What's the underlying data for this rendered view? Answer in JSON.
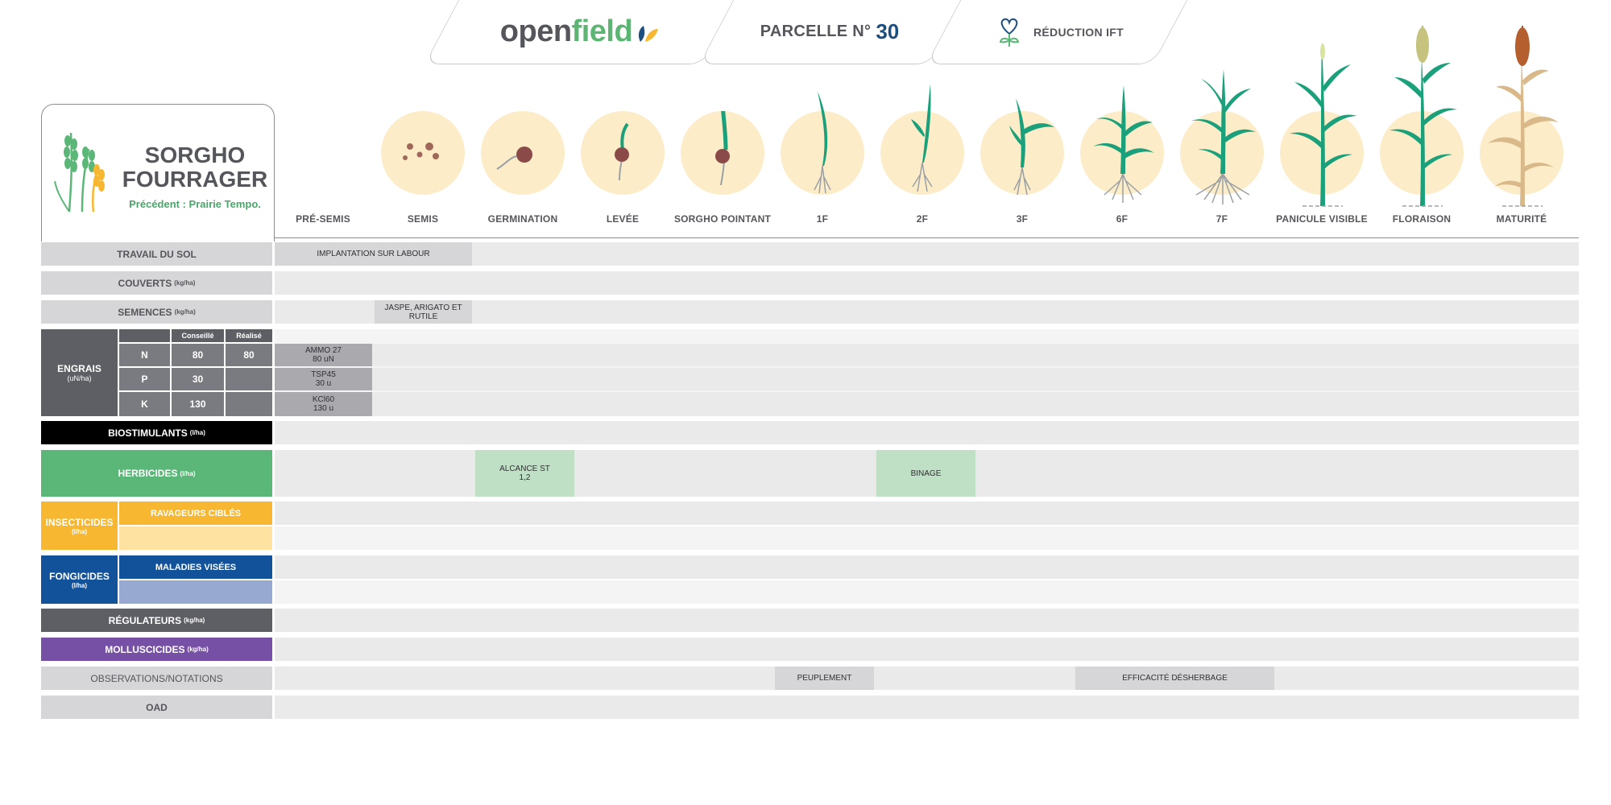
{
  "header": {
    "logo_part1": "open",
    "logo_part2": "field",
    "parcelle_label": "PARCELLE N°",
    "parcelle_number": "30",
    "reduction_label": "RÉDUCTION IFT"
  },
  "crop": {
    "title_line1": "SORGHO",
    "title_line2": "FOURRAGER",
    "subtitle": "Précédent : Prairie Tempo."
  },
  "stages": [
    "PRÉ-SEMIS",
    "SEMIS",
    "GERMINATION",
    "LEVÉE",
    "SORGHO POINTANT",
    "1F",
    "2F",
    "3F",
    "6F",
    "7F",
    "PANICULE VISIBLE",
    "FLORAISON",
    "MATURITÉ"
  ],
  "rows": {
    "travail": "TRAVAIL DU SOL",
    "couverts": "COUVERTS",
    "couverts_unit": "(kg/ha)",
    "semences": "SEMENCES",
    "semences_unit": "(kg/ha)",
    "engrais": "ENGRAIS",
    "engrais_unit": "(uN/ha)",
    "biostimulants": "BIOSTIMULANTS",
    "biostimulants_unit": "(l/ha)",
    "herbicides": "HERBICIDES",
    "herbicides_unit": "(l/ha)",
    "insecticides": "INSECTICIDES",
    "insecticides_unit": "(l/ha)",
    "ravageurs": "RAVAGEURS CIBLÉS",
    "fongicides": "FONGICIDES",
    "fongicides_unit": "(l/ha)",
    "maladies": "MALADIES VISÉES",
    "regulateurs": "RÉGULATEURS",
    "regulateurs_unit": "(kg/ha)",
    "molluscicides": "MOLLUSCICIDES",
    "molluscicides_unit": "(kg/ha)",
    "observations": "OBSERVATIONS/NOTATIONS",
    "oad": "OAD"
  },
  "engrais_table": {
    "col_conseille": "Conseillé",
    "col_realise": "Réalisé",
    "rows": [
      {
        "element": "N",
        "conseille": "80",
        "realise": "80",
        "product": "AMMO 27",
        "dose": "80 uN"
      },
      {
        "element": "P",
        "conseille": "30",
        "realise": "",
        "product": "TSP45",
        "dose": "30 u"
      },
      {
        "element": "K",
        "conseille": "130",
        "realise": "",
        "product": "KCl60",
        "dose": "130 u"
      }
    ]
  },
  "entries": {
    "travail": "IMPLANTATION SUR LABOUR",
    "semences_line1": "JASPE, ARIGATO ET",
    "semences_line2": "RUTILE",
    "herbicide1_line1": "ALCANCE ST",
    "herbicide1_line2": "1,2",
    "herbicide2": "BINAGE",
    "obs1": "PEUPLEMENT",
    "obs2": "EFFICACITÉ DÉSHERBAGE"
  },
  "colors": {
    "label_gray": "#d6d6d8",
    "engrais_dark": "#5e5f64",
    "biostimulants": "#000000",
    "herbicides": "#5bb777",
    "herbicide_cell": "#bfe0c4",
    "insecticides": "#f7b731",
    "insecticides_light": "#fde2a2",
    "fongicides": "#12529a",
    "fongicides_light": "#97a8d1",
    "regulateurs": "#5e5f64",
    "molluscicides": "#7650a5",
    "row_bg": "#eaeaeb",
    "stage_circle": "#fdecc8"
  }
}
